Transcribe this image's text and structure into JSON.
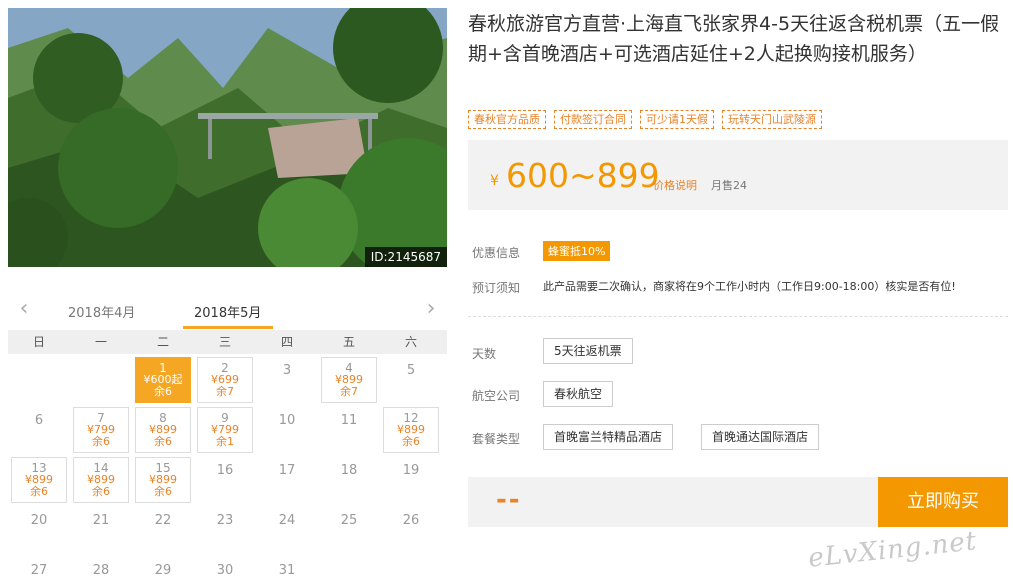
{
  "photo": {
    "id_label": "ID:2145687"
  },
  "product": {
    "title": "春秋旅游官方直营·上海直飞张家界4-5天往返含税机票（五一假期+含首晚酒店+可选酒店延住+2人起换购接机服务）",
    "tags": [
      "春秋官方品质",
      "付款签订合同",
      "可少请1天假",
      "玩转天门山武陵源"
    ]
  },
  "price": {
    "currency": "¥",
    "range": "600~899",
    "explain": "价格说明",
    "monthly_sales": "月售24"
  },
  "promo": {
    "label": "优惠信息",
    "badge": "蜂蜜抵10%"
  },
  "booking_notice": {
    "label": "预订须知",
    "text": "此产品需要二次确认，商家将在9个工作小时内（工作日9:00-18:00）核实是否有位!"
  },
  "options": {
    "days": {
      "label": "天数",
      "values": [
        "5天往返机票"
      ]
    },
    "airline": {
      "label": "航空公司",
      "values": [
        "春秋航空"
      ]
    },
    "package": {
      "label": "套餐类型",
      "values": [
        "首晚富兰特精品酒店",
        "首晚通达国际酒店"
      ]
    }
  },
  "buy": {
    "selected_price": "--",
    "button": "立即购买"
  },
  "calendar": {
    "prev_month": "2018年4月",
    "current_month": "2018年5月",
    "weekdays": [
      "日",
      "一",
      "二",
      "三",
      "四",
      "五",
      "六"
    ],
    "weeks": [
      [
        {
          "d": ""
        },
        {
          "d": ""
        },
        {
          "d": "1",
          "p": "¥600起",
          "r": "余6",
          "sel": true
        },
        {
          "d": "2",
          "p": "¥699",
          "r": "余7"
        },
        {
          "d": "3"
        },
        {
          "d": "4",
          "p": "¥899",
          "r": "余7"
        },
        {
          "d": "5"
        }
      ],
      [
        {
          "d": "6"
        },
        {
          "d": "7",
          "p": "¥799",
          "r": "余6"
        },
        {
          "d": "8",
          "p": "¥899",
          "r": "余6"
        },
        {
          "d": "9",
          "p": "¥799",
          "r": "余1"
        },
        {
          "d": "10"
        },
        {
          "d": "11"
        },
        {
          "d": "12",
          "p": "¥899",
          "r": "余6"
        }
      ],
      [
        {
          "d": "13",
          "p": "¥899",
          "r": "余6"
        },
        {
          "d": "14",
          "p": "¥899",
          "r": "余6"
        },
        {
          "d": "15",
          "p": "¥899",
          "r": "余6"
        },
        {
          "d": "16"
        },
        {
          "d": "17"
        },
        {
          "d": "18"
        },
        {
          "d": "19"
        }
      ],
      [
        {
          "d": "20"
        },
        {
          "d": "21"
        },
        {
          "d": "22"
        },
        {
          "d": "23"
        },
        {
          "d": "24"
        },
        {
          "d": "25"
        },
        {
          "d": "26"
        }
      ],
      [
        {
          "d": "27"
        },
        {
          "d": "28"
        },
        {
          "d": "29"
        },
        {
          "d": "30"
        },
        {
          "d": "31"
        },
        {
          "d": ""
        },
        {
          "d": ""
        }
      ]
    ]
  },
  "watermark": "eLvXing.net",
  "colors": {
    "accent": "#f39800",
    "tag": "#e8832a"
  }
}
